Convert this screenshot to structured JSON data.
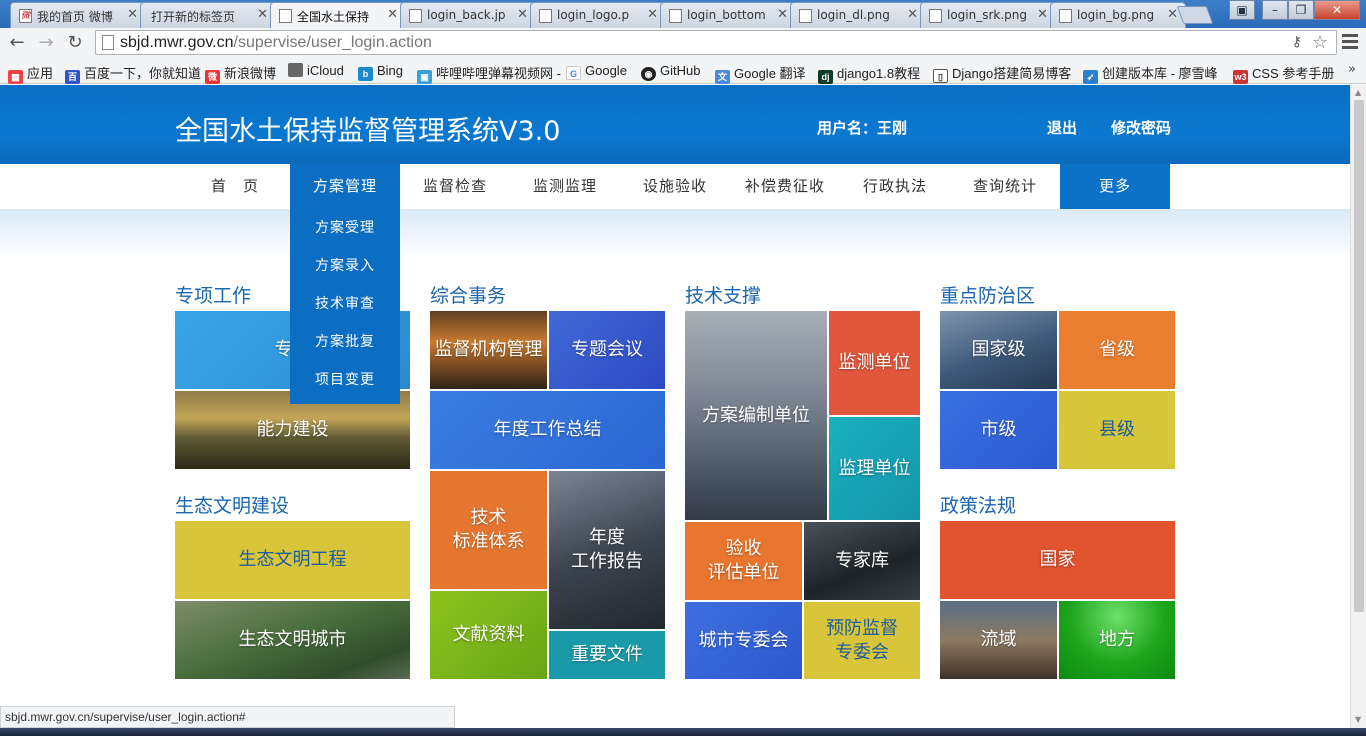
{
  "browser": {
    "tabs": [
      {
        "label": "我的首页 微博"
      },
      {
        "label": "打开新的标签页"
      },
      {
        "label": "全国水土保持"
      },
      {
        "label": "login_back.jp"
      },
      {
        "label": "login_logo.p"
      },
      {
        "label": "login_bottom"
      },
      {
        "label": "login_dl.png"
      },
      {
        "label": "login_srk.png"
      },
      {
        "label": "login_bg.png"
      }
    ],
    "url_host": "sbjd.mwr.gov.cn",
    "url_path": "/supervise/user_login.action",
    "bookmarks": [
      {
        "label": "应用"
      },
      {
        "label": "百度一下，你就知道"
      },
      {
        "label": "新浪微博"
      },
      {
        "label": "iCloud"
      },
      {
        "label": "Bing"
      },
      {
        "label": "哔哩哔哩弹幕视频网 -"
      },
      {
        "label": "Google"
      },
      {
        "label": "GitHub"
      },
      {
        "label": "Google 翻译"
      },
      {
        "label": "django1.8教程"
      },
      {
        "label": "Django搭建简易博客"
      },
      {
        "label": "创建版本库 - 廖雪峰"
      },
      {
        "label": "CSS 参考手册"
      }
    ],
    "bookmark_more": "»",
    "status_url": "sbjd.mwr.gov.cn/supervise/user_login.action#"
  },
  "header": {
    "title": "全国水土保持监督管理系统V3.0",
    "user_label": "用户名：",
    "user_name": "王刚",
    "logout": "退出",
    "change_password": "修改密码"
  },
  "nav": {
    "items": [
      "首　页",
      "方案管理",
      "监督检查",
      "监测监理",
      "设施验收",
      "补偿费征收",
      "行政执法",
      "查询统计",
      "更多"
    ],
    "dropdown": [
      "方案受理",
      "方案录入",
      "技术审查",
      "方案批复",
      "项目变更"
    ]
  },
  "sections": {
    "special": {
      "title": "专项工作",
      "tiles": [
        "专项",
        "能力建设"
      ]
    },
    "eco": {
      "title": "生态文明建设",
      "tiles": [
        "生态文明工程",
        "生态文明城市"
      ]
    },
    "general": {
      "title": "综合事务",
      "tiles": [
        "监督机构管理",
        "专题会议",
        "年度工作总结",
        "技术\n标准体系",
        "年度\n工作报告",
        "文献资料",
        "重要文件"
      ]
    },
    "tech": {
      "title": "技术支撑",
      "tiles": [
        "方案编制单位",
        "监测单位",
        "监理单位",
        "验收\n评估单位",
        "专家库",
        "城市专委会",
        "预防监督\n专委会"
      ]
    },
    "key": {
      "title": "重点防治区",
      "tiles": [
        "国家级",
        "省级",
        "市级",
        "县级"
      ]
    },
    "policy": {
      "title": "政策法规",
      "tiles": [
        "国家",
        "流域",
        "地方"
      ]
    }
  },
  "colors": {
    "header_blue": "#0b6fc4",
    "nav_active": "#0c6ec2",
    "section_title": "#1a66b0"
  }
}
